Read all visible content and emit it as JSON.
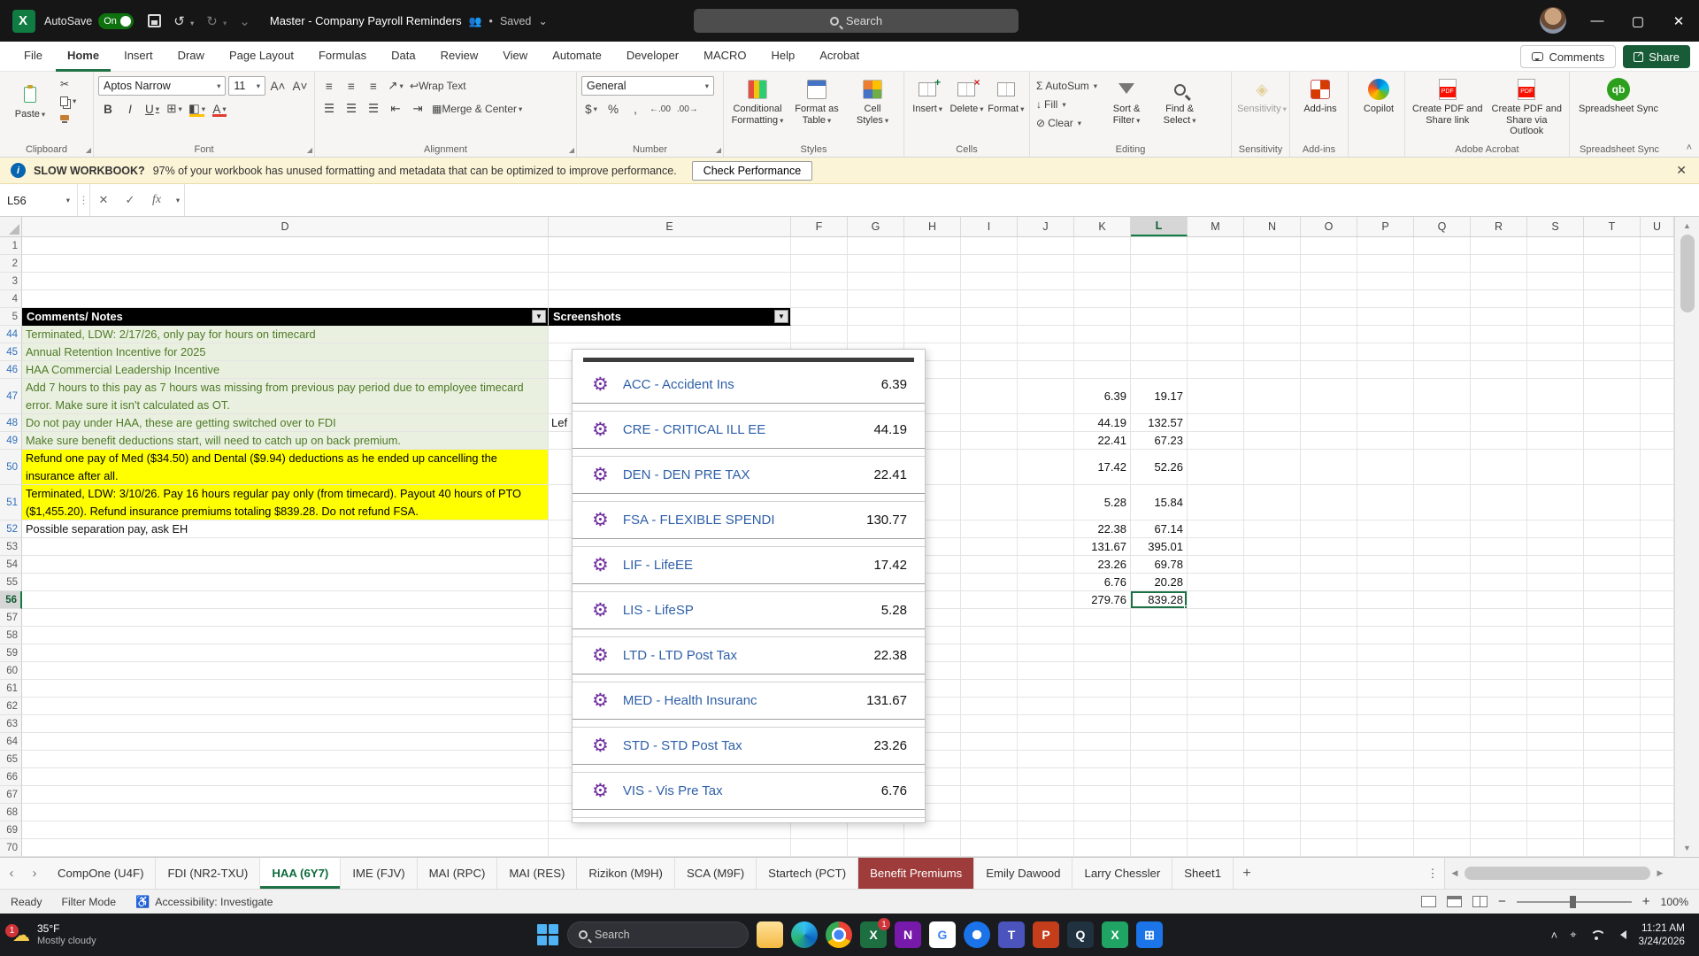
{
  "titlebar": {
    "autosave_label": "AutoSave",
    "autosave_state": "On",
    "title": "Master - Company Payroll Reminders",
    "saved_status": "Saved",
    "search_placeholder": "Search"
  },
  "ribbon_tabs": {
    "items": [
      "File",
      "Home",
      "Insert",
      "Draw",
      "Page Layout",
      "Formulas",
      "Data",
      "Review",
      "View",
      "Automate",
      "Developer",
      "MACRO",
      "Help",
      "Acrobat"
    ],
    "active": "Home",
    "comments_label": "Comments",
    "share_label": "Share"
  },
  "ribbon": {
    "clipboard": {
      "group_label": "Clipboard",
      "paste_label": "Paste"
    },
    "font": {
      "group_label": "Font",
      "font_name": "Aptos Narrow",
      "font_size": "11"
    },
    "alignment": {
      "group_label": "Alignment",
      "wrap_text_label": "Wrap Text",
      "merge_center_label": "Merge & Center"
    },
    "number": {
      "group_label": "Number",
      "number_format": "General"
    },
    "styles": {
      "group_label": "Styles",
      "conditional_label": "Conditional Formatting",
      "format_table_label": "Format as Table",
      "cell_styles_label": "Cell Styles"
    },
    "cells": {
      "group_label": "Cells",
      "insert_label": "Insert",
      "delete_label": "Delete",
      "format_label": "Format"
    },
    "editing": {
      "group_label": "Editing",
      "autosum_label": "AutoSum",
      "fill_label": "Fill",
      "clear_label": "Clear",
      "sort_label": "Sort & Filter",
      "find_label": "Find & Select"
    },
    "sensitivity": {
      "group_label": "Sensitivity",
      "button_label": "Sensitivity"
    },
    "addins": {
      "group_label": "Add-ins",
      "button_label": "Add-ins"
    },
    "copilot": {
      "button_label": "Copilot"
    },
    "acrobat": {
      "group_label": "Adobe Acrobat",
      "create_share_label": "Create PDF and Share link",
      "create_outlook_label": "Create PDF and Share via Outlook"
    },
    "sync": {
      "group_label": "Spreadsheet Sync",
      "button_label": "Spreadsheet Sync",
      "badge": "qb"
    }
  },
  "notification": {
    "title": "SLOW WORKBOOK?",
    "message": "97% of your workbook has unused formatting and metadata that can be optimized to improve performance.",
    "action_label": "Check Performance"
  },
  "formula_bar": {
    "name_box": "L56",
    "fx_label": "fx",
    "formula_value": ""
  },
  "grid": {
    "visible_columns": [
      "D",
      "E",
      "F",
      "G",
      "H",
      "I",
      "J",
      "K",
      "L",
      "M",
      "N",
      "O",
      "P",
      "Q",
      "R",
      "S",
      "T",
      "U"
    ],
    "selected_column": "L",
    "selected_cell": "L56",
    "table_headers": {
      "comments": "Comments/ Notes",
      "screenshots": "Screenshots"
    },
    "rows": [
      {
        "n": "1"
      },
      {
        "n": "2"
      },
      {
        "n": "3"
      },
      {
        "n": "4"
      },
      {
        "n": "5",
        "type": "header"
      },
      {
        "n": "44",
        "cls": "green",
        "d": "Terminated, LDW: 2/17/26, only pay for hours on timecard"
      },
      {
        "n": "45",
        "cls": "green",
        "d": "Annual Retention Incentive for 2025"
      },
      {
        "n": "46",
        "cls": "green",
        "d": "HAA Commercial Leadership Incentive"
      },
      {
        "n": "47",
        "h": 2,
        "cls": "green",
        "d": "Add 7 hours to this pay as 7 hours was missing from previous pay period due to employee timecard error. Make sure it isn't calculated as OT.",
        "k": "6.39",
        "l": "19.17"
      },
      {
        "n": "48",
        "cls": "green",
        "d": "Do not pay under HAA, these are getting switched over to FDI",
        "e": "Lef",
        "k": "44.19",
        "l": "132.57"
      },
      {
        "n": "49",
        "cls": "green",
        "d": "Make sure benefit deductions start, will need to catch up on back premium.",
        "k": "22.41",
        "l": "67.23"
      },
      {
        "n": "50",
        "h": 2,
        "cls": "yellow",
        "d": "Refund one pay of Med ($34.50) and Dental ($9.94) deductions as he ended up cancelling the insurance after all.",
        "k": "17.42",
        "l": "52.26"
      },
      {
        "n": "51",
        "h": 2,
        "cls": "yellow",
        "d": "Terminated, LDW: 3/10/26. Pay 16 hours regular pay only (from timecard). Payout 40 hours of PTO ($1,455.20). Refund insurance premiums totaling $839.28. Do not refund FSA.",
        "k": "5.28",
        "l": "15.84"
      },
      {
        "n": "52",
        "d": "Possible separation pay, ask EH",
        "k": "22.38",
        "l": "67.14"
      },
      {
        "n": "53",
        "k": "131.67",
        "l": "395.01"
      },
      {
        "n": "54",
        "k": "23.26",
        "l": "69.78"
      },
      {
        "n": "55",
        "k": "6.76",
        "l": "20.28"
      },
      {
        "n": "56",
        "k": "279.76",
        "l": "839.28",
        "sel": true
      },
      {
        "n": "57"
      },
      {
        "n": "58"
      },
      {
        "n": "59"
      },
      {
        "n": "60"
      },
      {
        "n": "61"
      },
      {
        "n": "62"
      },
      {
        "n": "63"
      },
      {
        "n": "64"
      },
      {
        "n": "65"
      },
      {
        "n": "66"
      },
      {
        "n": "67"
      },
      {
        "n": "68"
      },
      {
        "n": "69"
      },
      {
        "n": "70"
      }
    ]
  },
  "screenshot_overlay": {
    "items": [
      {
        "label": "ACC - Accident Ins",
        "amount": "6.39"
      },
      {
        "label": "CRE - CRITICAL ILL EE",
        "amount": "44.19"
      },
      {
        "label": "DEN - DEN PRE TAX",
        "amount": "22.41"
      },
      {
        "label": "FSA - FLEXIBLE SPENDI",
        "amount": "130.77"
      },
      {
        "label": "LIF - LifeEE",
        "amount": "17.42"
      },
      {
        "label": "LIS - LifeSP",
        "amount": "5.28"
      },
      {
        "label": "LTD - LTD Post Tax",
        "amount": "22.38"
      },
      {
        "label": "MED - Health Insuranc",
        "amount": "131.67"
      },
      {
        "label": "STD - STD Post Tax",
        "amount": "23.26"
      },
      {
        "label": "VIS - Vis Pre Tax",
        "amount": "6.76"
      }
    ]
  },
  "sheet_tabs": {
    "tabs": [
      {
        "label": "CompOne (U4F)"
      },
      {
        "label": "FDI (NR2-TXU)"
      },
      {
        "label": "HAA (6Y7)",
        "active": true
      },
      {
        "label": "IME (FJV)"
      },
      {
        "label": "MAI (RPC)"
      },
      {
        "label": "MAI (RES)"
      },
      {
        "label": "Rizikon (M9H)"
      },
      {
        "label": "SCA (M9F)"
      },
      {
        "label": "Startech (PCT)"
      },
      {
        "label": "Benefit Premiums",
        "color": "#9E3B3B"
      },
      {
        "label": "Emily Dawood"
      },
      {
        "label": "Larry Chessler"
      },
      {
        "label": "Sheet1"
      }
    ],
    "add_label": "+"
  },
  "status_bar": {
    "ready": "Ready",
    "filter_mode": "Filter Mode",
    "accessibility": "Accessibility: Investigate",
    "zoom": "100%"
  },
  "taskbar": {
    "weather_temp": "35°F",
    "weather_desc": "Mostly cloudy",
    "weather_badge": "1",
    "search_label": "Search",
    "time": "11:21 AM",
    "date": "3/24/2026",
    "icons": [
      {
        "name": "file-explorer"
      },
      {
        "name": "edge"
      },
      {
        "name": "chrome"
      },
      {
        "name": "excel",
        "text": "X",
        "badge": "1"
      },
      {
        "name": "onenote",
        "text": "N"
      },
      {
        "name": "google",
        "text": "G"
      },
      {
        "name": "browser"
      },
      {
        "name": "teams",
        "text": "T"
      },
      {
        "name": "powerpoint",
        "text": "P"
      },
      {
        "name": "quickbooks",
        "text": "Q"
      },
      {
        "name": "sheets",
        "text": "X"
      },
      {
        "name": "store",
        "text": "⊞"
      }
    ]
  },
  "colors": {
    "excel_green": "#217346",
    "selection_green": "#1E7145",
    "sheet_tab_red": "#9E3B3B",
    "note_green_bg": "#E9F0DF",
    "note_green_text": "#4F7A28",
    "highlight_yellow": "#FFFF00",
    "gear_purple": "#7030A0",
    "overlay_item_blue": "#2E5FA8"
  }
}
